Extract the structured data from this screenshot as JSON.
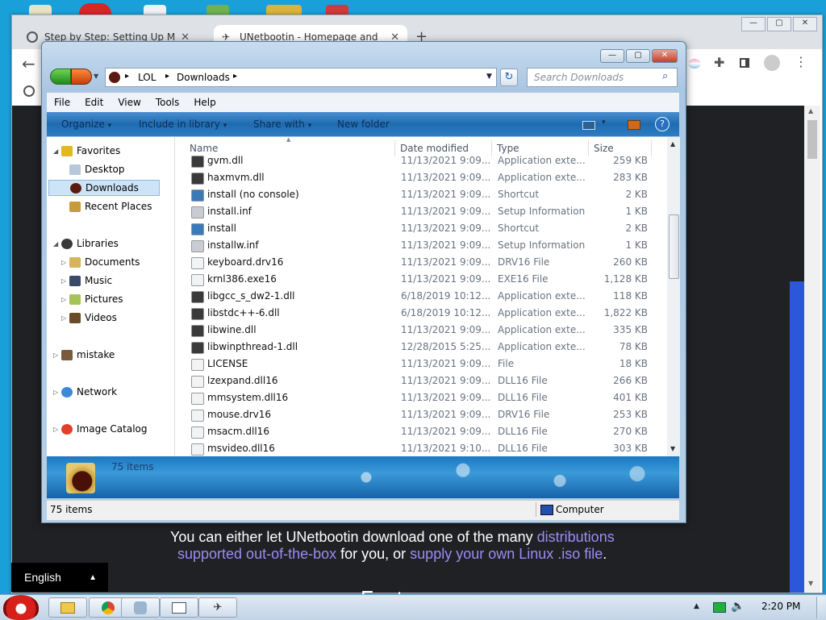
{
  "browser": {
    "tabs": [
      {
        "title": "Step by Step: Setting Up Micr",
        "close": "✕"
      },
      {
        "title": "UNetbootin - Homepage and",
        "close": "✕"
      }
    ],
    "new_tab": "+",
    "window_controls": [
      "—",
      "▢",
      "✕"
    ]
  },
  "webpage": {
    "line1_prefix": "You can either let UNetbootin download one of the many",
    "line1_link": "distributions",
    "line2_link1": "supported out-of-the-box",
    "line2_mid": " for you, or ",
    "line2_link2": "supply your own Linux .iso file",
    "line2_end": ".",
    "heading": "Features",
    "language": "English",
    "language_caret": "▲",
    "link_color": "#9a8cf5"
  },
  "explorer": {
    "controls": [
      "—",
      "▢",
      "✕"
    ],
    "address": {
      "sep": "▸",
      "path": [
        "LOL",
        "Downloads"
      ]
    },
    "search_placeholder": "Search Downloads",
    "menu": [
      "File",
      "Edit",
      "View",
      "Tools",
      "Help"
    ],
    "commands": [
      {
        "label": "Organize",
        "arrow": "▾"
      },
      {
        "label": "Include in library",
        "arrow": "▾"
      },
      {
        "label": "Share with",
        "arrow": "▾"
      },
      {
        "label": "New folder",
        "arrow": ""
      }
    ],
    "nav": [
      {
        "label": "Favorites",
        "twisty": "◢",
        "icon": "star-icon",
        "level": 0
      },
      {
        "label": "Desktop",
        "twisty": "",
        "icon": "desktop-icon",
        "level": 1
      },
      {
        "label": "Downloads",
        "twisty": "",
        "icon": "downloads-icon",
        "level": 1,
        "selected": true
      },
      {
        "label": "Recent Places",
        "twisty": "",
        "icon": "recent-places-icon",
        "level": 1
      },
      {
        "label": "Libraries",
        "twisty": "◢",
        "icon": "libraries-icon",
        "level": 0
      },
      {
        "label": "Documents",
        "twisty": "▷",
        "icon": "documents-icon",
        "level": 1
      },
      {
        "label": "Music",
        "twisty": "▷",
        "icon": "music-icon",
        "level": 1
      },
      {
        "label": "Pictures",
        "twisty": "▷",
        "icon": "pictures-icon",
        "level": 1
      },
      {
        "label": "Videos",
        "twisty": "▷",
        "icon": "videos-icon",
        "level": 1
      },
      {
        "label": "mistake",
        "twisty": "▷",
        "icon": "user-folder-icon",
        "level": 0
      },
      {
        "label": "Network",
        "twisty": "▷",
        "icon": "network-icon",
        "level": 0
      },
      {
        "label": "Image Catalog",
        "twisty": "▷",
        "icon": "image-catalog-icon",
        "level": 0
      }
    ],
    "columns": [
      "Name",
      "Date modified",
      "Type",
      "Size"
    ],
    "sort_arrow": "▲",
    "files": [
      {
        "name": "gvm.dll",
        "date": "11/13/2021 9:09...",
        "type": "Application exte...",
        "size": "259 KB",
        "kind": "app"
      },
      {
        "name": "haxmvm.dll",
        "date": "11/13/2021 9:09...",
        "type": "Application exte...",
        "size": "283 KB",
        "kind": "app"
      },
      {
        "name": "install (no console)",
        "date": "11/13/2021 9:09...",
        "type": "Shortcut",
        "size": "2 KB",
        "kind": "shortcut"
      },
      {
        "name": "install.inf",
        "date": "11/13/2021 9:09...",
        "type": "Setup Information",
        "size": "1 KB",
        "kind": "inf"
      },
      {
        "name": "install",
        "date": "11/13/2021 9:09...",
        "type": "Shortcut",
        "size": "2 KB",
        "kind": "shortcut"
      },
      {
        "name": "installw.inf",
        "date": "11/13/2021 9:09...",
        "type": "Setup Information",
        "size": "1 KB",
        "kind": "inf"
      },
      {
        "name": "keyboard.drv16",
        "date": "11/13/2021 9:09...",
        "type": "DRV16 File",
        "size": "260 KB",
        "kind": "file"
      },
      {
        "name": "krnl386.exe16",
        "date": "11/13/2021 9:09...",
        "type": "EXE16 File",
        "size": "1,128 KB",
        "kind": "file"
      },
      {
        "name": "libgcc_s_dw2-1.dll",
        "date": "6/18/2019 10:12...",
        "type": "Application exte...",
        "size": "118 KB",
        "kind": "app"
      },
      {
        "name": "libstdc++-6.dll",
        "date": "6/18/2019 10:12...",
        "type": "Application exte...",
        "size": "1,822 KB",
        "kind": "app"
      },
      {
        "name": "libwine.dll",
        "date": "11/13/2021 9:09...",
        "type": "Application exte...",
        "size": "335 KB",
        "kind": "app"
      },
      {
        "name": "libwinpthread-1.dll",
        "date": "12/28/2015 5:25...",
        "type": "Application exte...",
        "size": "78 KB",
        "kind": "app"
      },
      {
        "name": "LICENSE",
        "date": "11/13/2021 9:09...",
        "type": "File",
        "size": "18 KB",
        "kind": "file"
      },
      {
        "name": "lzexpand.dll16",
        "date": "11/13/2021 9:09...",
        "type": "DLL16 File",
        "size": "266 KB",
        "kind": "file"
      },
      {
        "name": "mmsystem.dll16",
        "date": "11/13/2021 9:09...",
        "type": "DLL16 File",
        "size": "401 KB",
        "kind": "file"
      },
      {
        "name": "mouse.drv16",
        "date": "11/13/2021 9:09...",
        "type": "DRV16 File",
        "size": "253 KB",
        "kind": "file"
      },
      {
        "name": "msacm.dll16",
        "date": "11/13/2021 9:09...",
        "type": "DLL16 File",
        "size": "270 KB",
        "kind": "file"
      },
      {
        "name": "msvideo.dll16",
        "date": "11/13/2021 9:10...",
        "type": "DLL16 File",
        "size": "303 KB",
        "kind": "file"
      }
    ],
    "details_count": "75 items",
    "status_count": "75 items",
    "status_location": "Computer"
  },
  "taskbar": {
    "clock": "2:20 PM",
    "tray_arrow": "▲"
  }
}
